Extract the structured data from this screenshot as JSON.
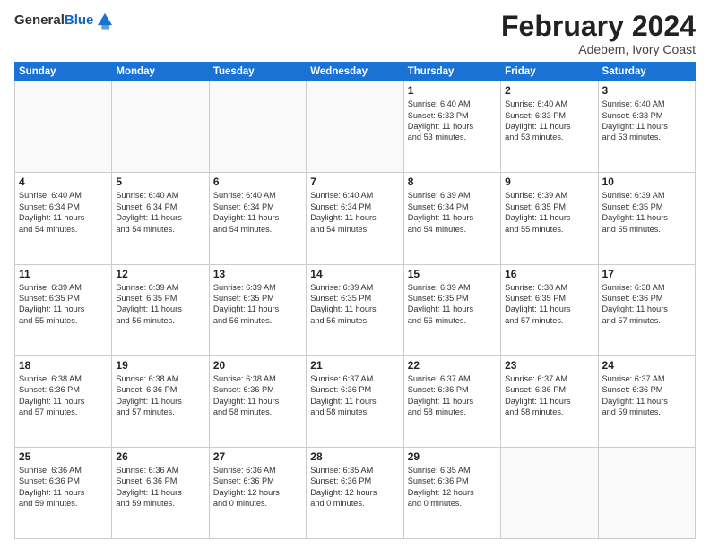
{
  "header": {
    "logo_general": "General",
    "logo_blue": "Blue",
    "title": "February 2024",
    "location": "Adebem, Ivory Coast"
  },
  "days_of_week": [
    "Sunday",
    "Monday",
    "Tuesday",
    "Wednesday",
    "Thursday",
    "Friday",
    "Saturday"
  ],
  "weeks": [
    [
      {
        "day": "",
        "info": ""
      },
      {
        "day": "",
        "info": ""
      },
      {
        "day": "",
        "info": ""
      },
      {
        "day": "",
        "info": ""
      },
      {
        "day": "1",
        "info": "Sunrise: 6:40 AM\nSunset: 6:33 PM\nDaylight: 11 hours\nand 53 minutes."
      },
      {
        "day": "2",
        "info": "Sunrise: 6:40 AM\nSunset: 6:33 PM\nDaylight: 11 hours\nand 53 minutes."
      },
      {
        "day": "3",
        "info": "Sunrise: 6:40 AM\nSunset: 6:33 PM\nDaylight: 11 hours\nand 53 minutes."
      }
    ],
    [
      {
        "day": "4",
        "info": "Sunrise: 6:40 AM\nSunset: 6:34 PM\nDaylight: 11 hours\nand 54 minutes."
      },
      {
        "day": "5",
        "info": "Sunrise: 6:40 AM\nSunset: 6:34 PM\nDaylight: 11 hours\nand 54 minutes."
      },
      {
        "day": "6",
        "info": "Sunrise: 6:40 AM\nSunset: 6:34 PM\nDaylight: 11 hours\nand 54 minutes."
      },
      {
        "day": "7",
        "info": "Sunrise: 6:40 AM\nSunset: 6:34 PM\nDaylight: 11 hours\nand 54 minutes."
      },
      {
        "day": "8",
        "info": "Sunrise: 6:39 AM\nSunset: 6:34 PM\nDaylight: 11 hours\nand 54 minutes."
      },
      {
        "day": "9",
        "info": "Sunrise: 6:39 AM\nSunset: 6:35 PM\nDaylight: 11 hours\nand 55 minutes."
      },
      {
        "day": "10",
        "info": "Sunrise: 6:39 AM\nSunset: 6:35 PM\nDaylight: 11 hours\nand 55 minutes."
      }
    ],
    [
      {
        "day": "11",
        "info": "Sunrise: 6:39 AM\nSunset: 6:35 PM\nDaylight: 11 hours\nand 55 minutes."
      },
      {
        "day": "12",
        "info": "Sunrise: 6:39 AM\nSunset: 6:35 PM\nDaylight: 11 hours\nand 56 minutes."
      },
      {
        "day": "13",
        "info": "Sunrise: 6:39 AM\nSunset: 6:35 PM\nDaylight: 11 hours\nand 56 minutes."
      },
      {
        "day": "14",
        "info": "Sunrise: 6:39 AM\nSunset: 6:35 PM\nDaylight: 11 hours\nand 56 minutes."
      },
      {
        "day": "15",
        "info": "Sunrise: 6:39 AM\nSunset: 6:35 PM\nDaylight: 11 hours\nand 56 minutes."
      },
      {
        "day": "16",
        "info": "Sunrise: 6:38 AM\nSunset: 6:35 PM\nDaylight: 11 hours\nand 57 minutes."
      },
      {
        "day": "17",
        "info": "Sunrise: 6:38 AM\nSunset: 6:36 PM\nDaylight: 11 hours\nand 57 minutes."
      }
    ],
    [
      {
        "day": "18",
        "info": "Sunrise: 6:38 AM\nSunset: 6:36 PM\nDaylight: 11 hours\nand 57 minutes."
      },
      {
        "day": "19",
        "info": "Sunrise: 6:38 AM\nSunset: 6:36 PM\nDaylight: 11 hours\nand 57 minutes."
      },
      {
        "day": "20",
        "info": "Sunrise: 6:38 AM\nSunset: 6:36 PM\nDaylight: 11 hours\nand 58 minutes."
      },
      {
        "day": "21",
        "info": "Sunrise: 6:37 AM\nSunset: 6:36 PM\nDaylight: 11 hours\nand 58 minutes."
      },
      {
        "day": "22",
        "info": "Sunrise: 6:37 AM\nSunset: 6:36 PM\nDaylight: 11 hours\nand 58 minutes."
      },
      {
        "day": "23",
        "info": "Sunrise: 6:37 AM\nSunset: 6:36 PM\nDaylight: 11 hours\nand 58 minutes."
      },
      {
        "day": "24",
        "info": "Sunrise: 6:37 AM\nSunset: 6:36 PM\nDaylight: 11 hours\nand 59 minutes."
      }
    ],
    [
      {
        "day": "25",
        "info": "Sunrise: 6:36 AM\nSunset: 6:36 PM\nDaylight: 11 hours\nand 59 minutes."
      },
      {
        "day": "26",
        "info": "Sunrise: 6:36 AM\nSunset: 6:36 PM\nDaylight: 11 hours\nand 59 minutes."
      },
      {
        "day": "27",
        "info": "Sunrise: 6:36 AM\nSunset: 6:36 PM\nDaylight: 12 hours\nand 0 minutes."
      },
      {
        "day": "28",
        "info": "Sunrise: 6:35 AM\nSunset: 6:36 PM\nDaylight: 12 hours\nand 0 minutes."
      },
      {
        "day": "29",
        "info": "Sunrise: 6:35 AM\nSunset: 6:36 PM\nDaylight: 12 hours\nand 0 minutes."
      },
      {
        "day": "",
        "info": ""
      },
      {
        "day": "",
        "info": ""
      }
    ]
  ]
}
